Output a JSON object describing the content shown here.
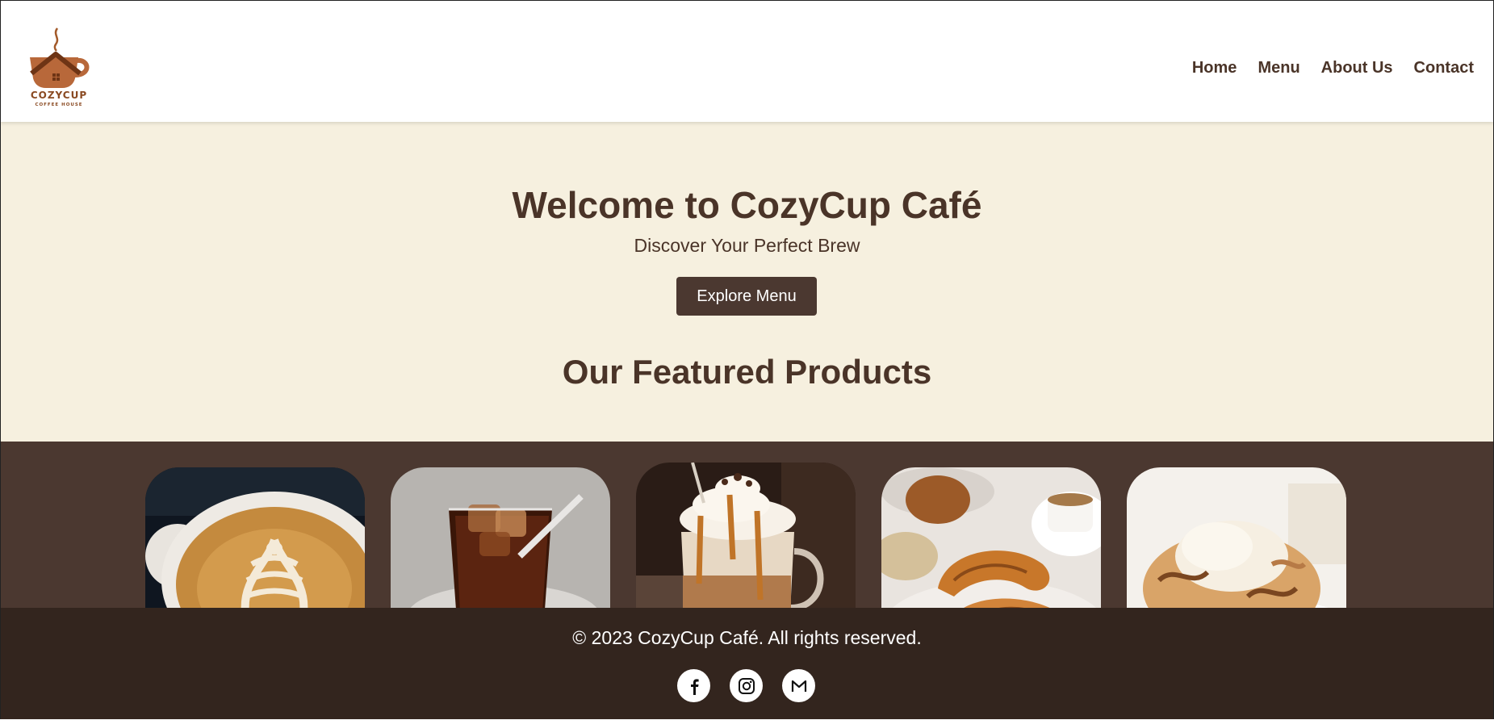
{
  "brand": {
    "logo_text": "COZYCUP",
    "logo_subtext": "COFFEE HOUSE",
    "logo_color": "#8a4a22"
  },
  "nav": {
    "items": [
      {
        "label": "Home"
      },
      {
        "label": "Menu"
      },
      {
        "label": "About Us"
      },
      {
        "label": "Contact"
      }
    ]
  },
  "hero": {
    "title": "Welcome to CozyCup Café",
    "tagline": "Discover Your Perfect Brew",
    "cta_label": "Explore Menu"
  },
  "featured": {
    "heading": "Our Featured Products",
    "products": [
      {
        "icon": "latte-art-image"
      },
      {
        "icon": "iced-coffee-image"
      },
      {
        "icon": "caramel-macchiato-image"
      },
      {
        "icon": "croissant-image"
      },
      {
        "icon": "cinnamon-roll-image"
      }
    ]
  },
  "footer": {
    "copyright": "© 2023 CozyCup Café. All rights reserved.",
    "socials": [
      {
        "icon": "facebook-icon"
      },
      {
        "icon": "instagram-icon"
      },
      {
        "icon": "gmail-icon"
      }
    ]
  },
  "colors": {
    "text_brown": "#4a3428",
    "hero_bg": "#f6f0df",
    "products_bg": "#4b3830",
    "footer_bg": "#33251e"
  }
}
